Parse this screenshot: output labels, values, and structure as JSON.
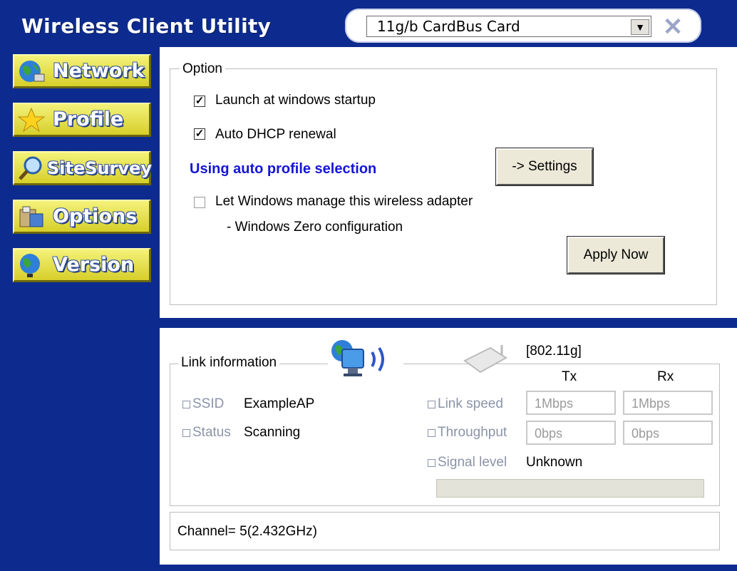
{
  "app": {
    "title": "Wireless Client Utility",
    "adapter_selected": "11g/b CardBus Card",
    "dropdown_glyph": "▼",
    "close_glyph": "✕"
  },
  "sidebar": {
    "items": [
      {
        "label": "Network",
        "icon": "globe-network-icon"
      },
      {
        "label": "Profile",
        "icon": "star-icon"
      },
      {
        "label": "SiteSurvey",
        "icon": "magnifier-icon"
      },
      {
        "label": "Options",
        "icon": "options-tools-icon"
      },
      {
        "label": "Version",
        "icon": "globe-version-icon"
      }
    ]
  },
  "options": {
    "group_label": "Option",
    "launch_startup_label": "Launch at windows startup",
    "launch_startup_checked": true,
    "auto_dhcp_label": "Auto DHCP renewal",
    "auto_dhcp_checked": true,
    "auto_profile_text": "Using auto profile selection",
    "settings_button": "-> Settings",
    "windows_manage_label": "Let Windows manage this wireless adapter",
    "windows_manage_checked": false,
    "windows_zero_text": "- Windows Zero configuration",
    "apply_button": "Apply Now",
    "check_glyph": "✓"
  },
  "link": {
    "group_label": "Link information",
    "mode": "[802.11g]",
    "tx_header": "Tx",
    "rx_header": "Rx",
    "ssid_label": "SSID",
    "ssid_value": "ExampleAP",
    "status_label": "Status",
    "status_value": "Scanning",
    "link_speed_label": "Link speed",
    "link_speed_tx": "1Mbps",
    "link_speed_rx": "1Mbps",
    "throughput_label": "Throughput",
    "throughput_tx": "0bps",
    "throughput_rx": "0bps",
    "signal_label": "Signal level",
    "signal_value": "Unknown",
    "signal_level_fraction": 0
  },
  "channel": {
    "text": "Channel= 5(2.432GHz)"
  },
  "colors": {
    "frame_blue": "#0d2b8f",
    "nav_yellow": "#e8e34e",
    "link_blue": "#1515d6",
    "muted_label": "#8b93a8"
  }
}
